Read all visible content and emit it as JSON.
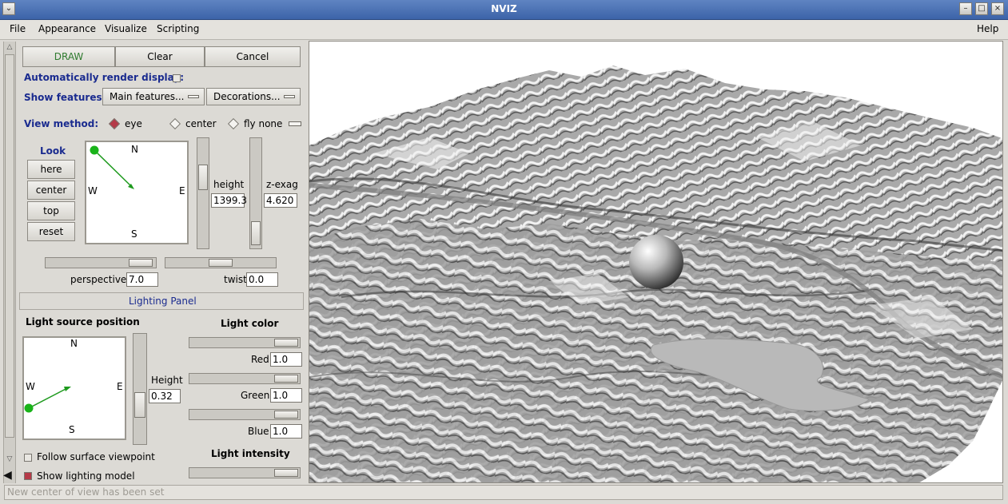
{
  "window": {
    "title": "NVIZ"
  },
  "menubar": {
    "file": "File",
    "appearance": "Appearance",
    "visualize": "Visualize",
    "scripting": "Scripting",
    "help": "Help"
  },
  "toolbar": {
    "draw": "DRAW",
    "clear": "Clear",
    "cancel": "Cancel"
  },
  "auto_render": {
    "label": "Automatically render display:",
    "checked": false
  },
  "show_features": {
    "label": "Show features:",
    "main": "Main features...",
    "decorations": "Decorations..."
  },
  "view_method": {
    "label": "View method:",
    "eye": "eye",
    "center": "center",
    "fly": "fly none",
    "selected": "eye"
  },
  "look": {
    "label": "Look",
    "here": "here",
    "center": "center",
    "top": "top",
    "reset": "reset"
  },
  "compass": {
    "n": "N",
    "s": "S",
    "e": "E",
    "w": "W"
  },
  "view": {
    "height_label": "height",
    "height_value": "1399.3",
    "zexag_label": "z-exag",
    "zexag_value": "4.620",
    "perspective_label": "perspective",
    "perspective_value": "7.0",
    "twist_label": "twist",
    "twist_value": "0.0"
  },
  "lighting": {
    "panel_title": "Lighting Panel",
    "source_label": "Light source position",
    "height_label": "Height",
    "height_value": "0.32",
    "color_label": "Light color",
    "red_label": "Red",
    "red_value": "1.0",
    "green_label": "Green",
    "green_value": "1.0",
    "blue_label": "Blue",
    "blue_value": "1.0",
    "intensity_label": "Light intensity",
    "follow_label": "Follow surface viewpoint",
    "show_model_label": "Show lighting model",
    "follow_checked": false,
    "show_model_checked": true
  },
  "status": {
    "text": "New center of view has been set"
  },
  "colors": {
    "accent": "#1a2b8f",
    "draw_text": "#2f7a2f",
    "checked": "#b53a48",
    "title_bar": "#4a70b4"
  }
}
